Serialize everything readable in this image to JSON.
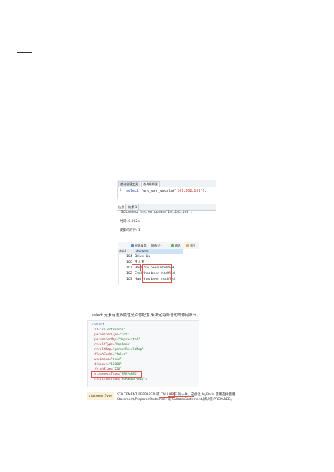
{
  "editor": {
    "tabs": [
      "查询创建工具",
      "查询编辑器"
    ],
    "line_number": "1",
    "code_keyword": "select",
    "code_func": "func_err_update(",
    "code_args": "'101,102,103'",
    "code_end": ");"
  },
  "results": {
    "tabs": [
      "信息",
      "结果 1"
    ],
    "sql_line": "[SQL]select func_err_update('101,102,103');",
    "time_line": "时间: 0.002s",
    "affected_line": "受影响的行: 1"
  },
  "grid": {
    "toolbar": [
      "开始事务",
      "备注 ·",
      "筛选",
      "排序"
    ],
    "headers": [
      "stuid",
      "stuname"
    ],
    "rows": [
      {
        "id": "104",
        "name": "Driver Liu"
      },
      {
        "id": "100",
        "name": "王大宝"
      },
      {
        "id": "101",
        "name": "Hank has been modified."
      },
      {
        "id": "102",
        "name": "Emily has been modified."
      },
      {
        "id": "103",
        "name": "Harry has been modified."
      }
    ]
  },
  "caption": "select 元素有很多属性允许你配置,来决定每条语句的作用细节。",
  "xml": {
    "lines": [
      {
        "tag": "<select",
        "attr": "",
        "val": ""
      },
      {
        "tag": "",
        "attr": "id=",
        "val": "\"selectPerson\""
      },
      {
        "tag": "",
        "attr": "parameterType=",
        "val": "\"int\""
      },
      {
        "tag": "",
        "attr": "parameterMap=",
        "val": "\"deprecated\""
      },
      {
        "tag": "",
        "attr": "resultType=",
        "val": "\"hashmap\""
      },
      {
        "tag": "",
        "attr": "resultMap=",
        "val": "\"personResultMap\""
      },
      {
        "tag": "",
        "attr": "flushCache=",
        "val": "\"false\""
      },
      {
        "tag": "",
        "attr": "useCache=",
        "val": "\"true\""
      },
      {
        "tag": "",
        "attr": "timeout=",
        "val": "\"10000\""
      },
      {
        "tag": "",
        "attr": "fetchSize=",
        "val": "\"256\""
      },
      {
        "tag": "",
        "attr": "statementType=",
        "val": "\"PREPARED\""
      },
      {
        "tag": "",
        "attr": "resultSetType=",
        "val": "\"FORWARD_ONLY\">"
      }
    ]
  },
  "statement_type": {
    "label": "statementType",
    "line1": "STA TEMENT,PREPARED 或 CALLABLE 的一种。这会让 MyBatis 使用选择使用",
    "line2": "Statement,PreparedStatement 或 CallableStatement,默认值:PREPARED。"
  }
}
